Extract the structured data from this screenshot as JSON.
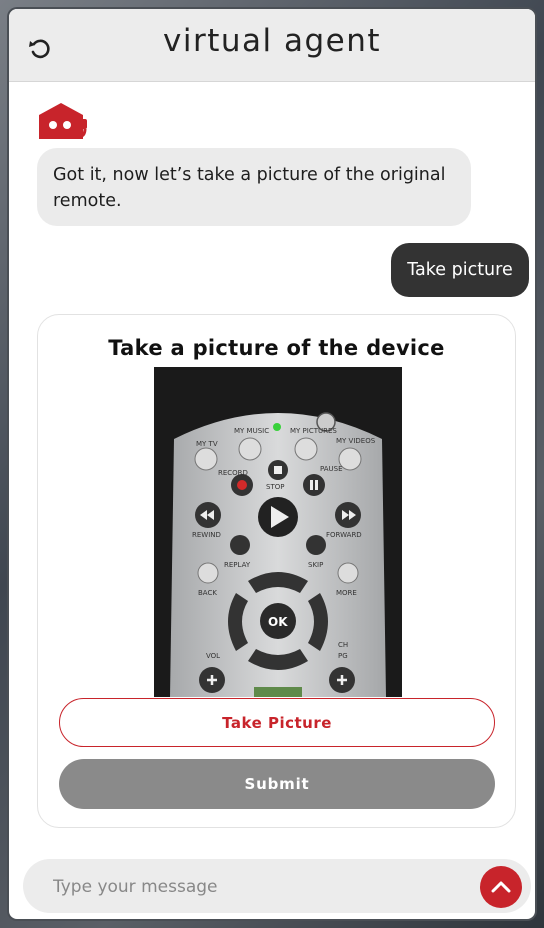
{
  "header": {
    "title": "virtual agent",
    "back_icon": "undo-icon"
  },
  "chat": {
    "agent_avatar_icon": "robot-agent-icon",
    "agent_message": "Got it, now let’s take a picture of the original remote.",
    "user_message": "Take picture"
  },
  "capture_card": {
    "title": "Take a picture of the device",
    "photo": {
      "labels": {
        "my_tv": "MY TV",
        "my_music": "MY MUSIC",
        "my_pictures": "MY PICTURES",
        "my_videos": "MY VIDEOS",
        "record": "RECORD",
        "stop": "STOP",
        "pause": "PAUSE",
        "rewind": "REWIND",
        "forward": "FORWARD",
        "replay": "REPLAY",
        "skip": "SKIP",
        "back": "BACK",
        "more": "MORE",
        "ok": "OK",
        "vol": "VOL",
        "ch": "CH",
        "pg": "PG"
      }
    },
    "take_picture_label": "Take Picture",
    "submit_label": "Submit"
  },
  "composer": {
    "placeholder": "Type your message",
    "send_icon": "chevron-up-icon"
  },
  "colors": {
    "accent": "#c8242b",
    "submit_bg": "#8a8a8a",
    "user_bubble": "#333333",
    "agent_bubble": "#ebebeb"
  }
}
